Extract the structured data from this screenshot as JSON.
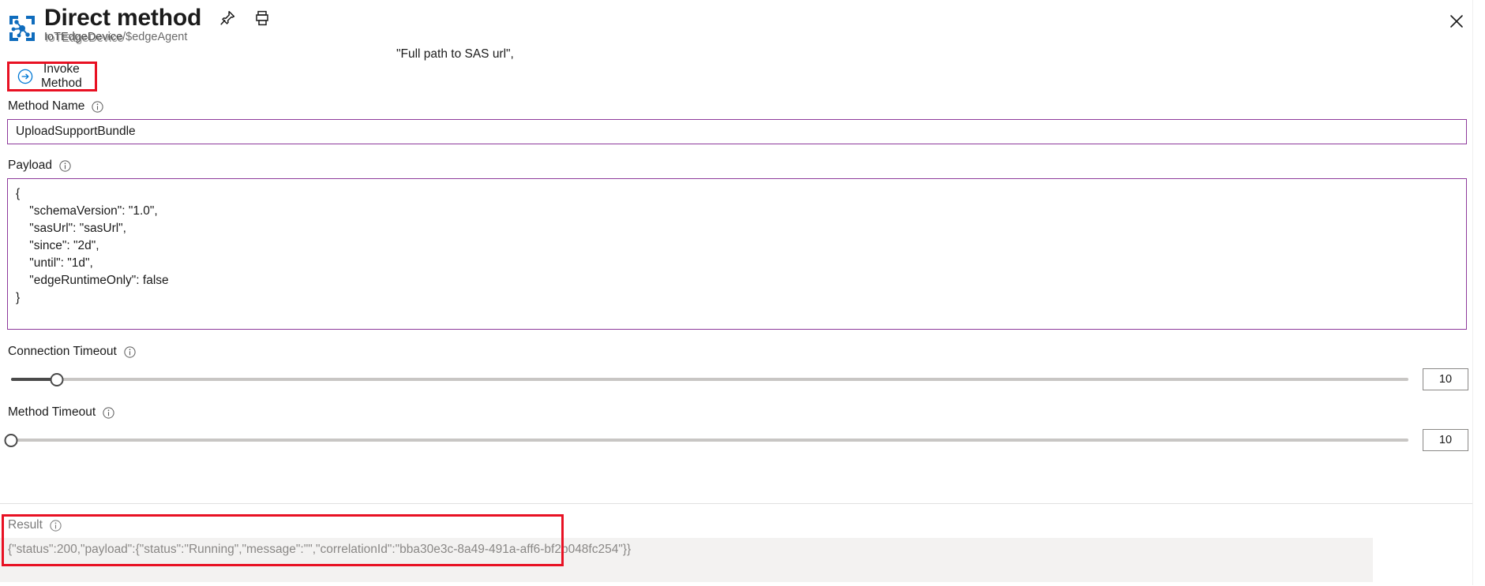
{
  "header": {
    "title": "Direct method",
    "subtitle_prefix": "IoTEdgeDevice",
    "subtitle_suffix": "/$edgeAgent",
    "hub_icon": "iot-hub-icon",
    "pin_icon": "pin-icon",
    "print_icon": "print-icon",
    "close_icon": "close-icon"
  },
  "annotation": {
    "floating_note": "\"Full path to SAS url\",",
    "highlight_color": "#e81123"
  },
  "command_bar": {
    "invoke_label": "Invoke Method",
    "invoke_icon": "arrow-right-circle-icon"
  },
  "fields": {
    "method_name": {
      "label": "Method Name",
      "value": "UploadSupportBundle",
      "placeholder": "",
      "info_icon": "info-icon"
    },
    "payload": {
      "label": "Payload",
      "value": "{\n    \"schemaVersion\": \"1.0\",\n    \"sasUrl\": \"sasUrl\",\n    \"since\": \"2d\",\n    \"until\": \"1d\",\n    \"edgeRuntimeOnly\": false\n}",
      "placeholder": "",
      "info_icon": "info-icon"
    },
    "connection_timeout": {
      "label": "Connection Timeout",
      "value": "10",
      "percent": 3.3,
      "info_icon": "info-icon"
    },
    "method_timeout": {
      "label": "Method Timeout",
      "value": "10",
      "percent": 0,
      "info_icon": "info-icon"
    }
  },
  "result": {
    "label": "Result",
    "value": "{\"status\":200,\"payload\":{\"status\":\"Running\",\"message\":\"\",\"correlationId\":\"bba30e3c-8a49-491a-aff6-bf2b048fc254\"}}",
    "info_icon": "info-icon"
  },
  "colors": {
    "accent": "#0078d4",
    "input_border": "#8e3a9b",
    "annotation_red": "#e81123",
    "result_background": "#f3f2f1"
  }
}
